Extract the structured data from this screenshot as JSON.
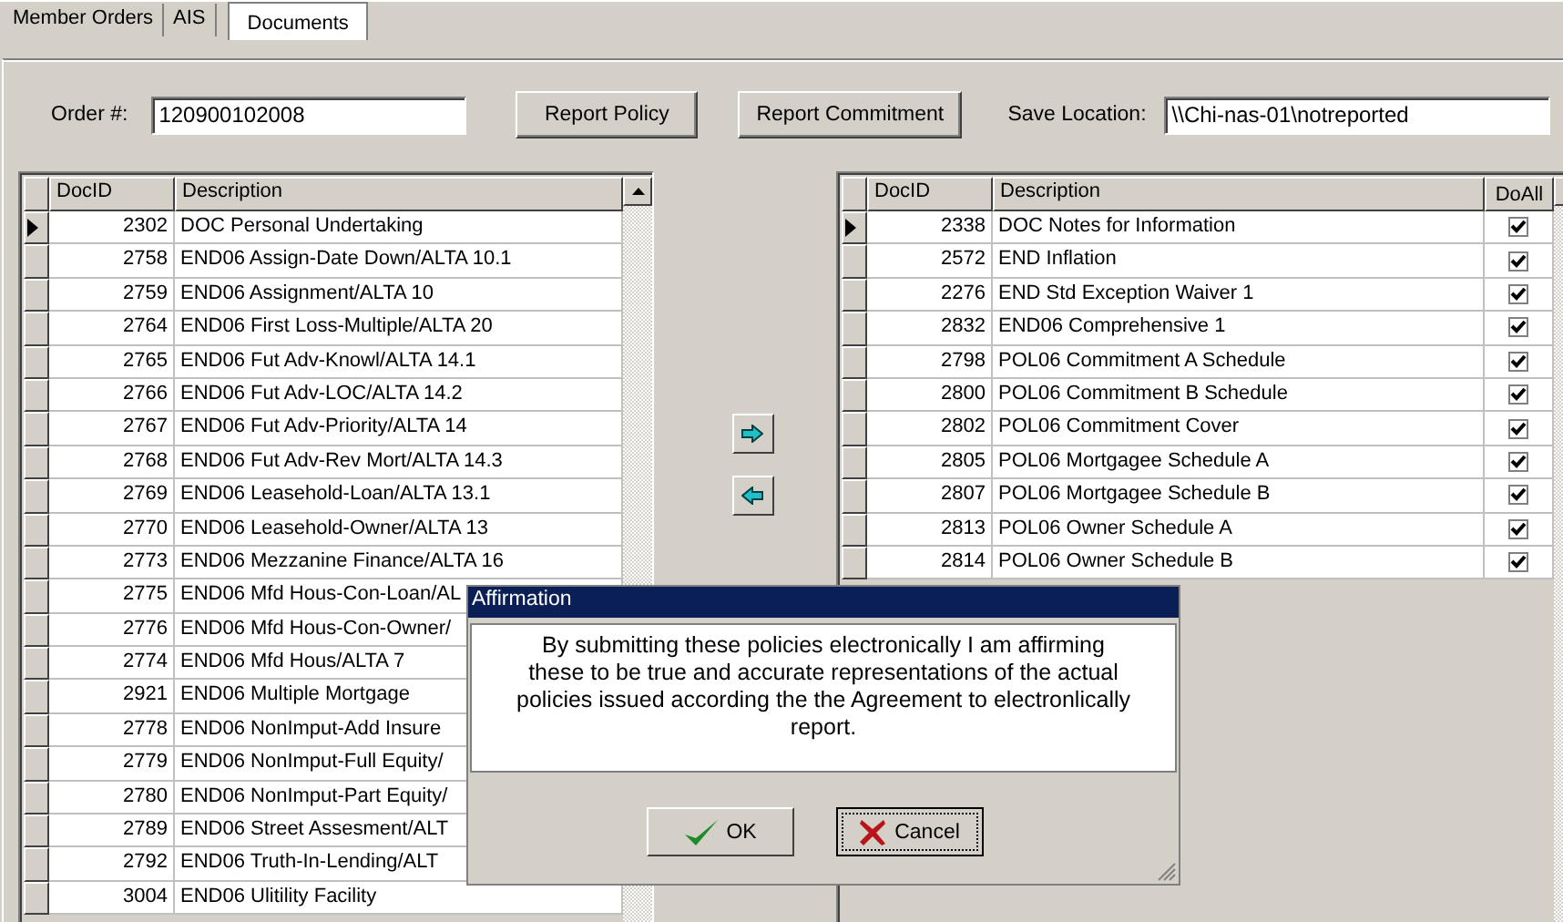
{
  "tabs": [
    {
      "label": "Member Orders",
      "selected": false
    },
    {
      "label": "AIS",
      "selected": false
    },
    {
      "label": "Documents",
      "selected": true
    }
  ],
  "order": {
    "label": "Order #:",
    "value": "120900102008"
  },
  "buttons": [
    "Report Policy",
    "Report Commitment"
  ],
  "save_location": {
    "label": "Save Location:",
    "value": "\\\\Chi-nas-01\\notreported"
  },
  "available_grid": {
    "columns": [
      "DocID",
      "Description"
    ],
    "rows": [
      {
        "doc_id": "2302",
        "description": "DOC Personal Undertaking",
        "selected": true
      },
      {
        "doc_id": "2758",
        "description": "END06 Assign-Date Down/ALTA 10.1",
        "selected": false
      },
      {
        "doc_id": "2759",
        "description": "END06 Assignment/ALTA 10",
        "selected": false
      },
      {
        "doc_id": "2764",
        "description": "END06 First Loss-Multiple/ALTA 20",
        "selected": false
      },
      {
        "doc_id": "2765",
        "description": "END06 Fut Adv-Knowl/ALTA 14.1",
        "selected": false
      },
      {
        "doc_id": "2766",
        "description": "END06 Fut Adv-LOC/ALTA 14.2",
        "selected": false
      },
      {
        "doc_id": "2767",
        "description": "END06 Fut Adv-Priority/ALTA 14",
        "selected": false
      },
      {
        "doc_id": "2768",
        "description": "END06 Fut Adv-Rev Mort/ALTA 14.3",
        "selected": false
      },
      {
        "doc_id": "2769",
        "description": "END06 Leasehold-Loan/ALTA 13.1",
        "selected": false
      },
      {
        "doc_id": "2770",
        "description": "END06 Leasehold-Owner/ALTA 13",
        "selected": false
      },
      {
        "doc_id": "2773",
        "description": "END06 Mezzanine Finance/ALTA 16",
        "selected": false
      },
      {
        "doc_id": "2775",
        "description": "END06 Mfd Hous-Con-Loan/AL",
        "selected": false
      },
      {
        "doc_id": "2776",
        "description": "END06 Mfd Hous-Con-Owner/",
        "selected": false
      },
      {
        "doc_id": "2774",
        "description": "END06 Mfd Hous/ALTA 7",
        "selected": false
      },
      {
        "doc_id": "2921",
        "description": "END06 Multiple Mortgage",
        "selected": false
      },
      {
        "doc_id": "2778",
        "description": "END06 NonImput-Add Insure",
        "selected": false
      },
      {
        "doc_id": "2779",
        "description": "END06 NonImput-Full Equity/",
        "selected": false
      },
      {
        "doc_id": "2780",
        "description": "END06 NonImput-Part Equity/",
        "selected": false
      },
      {
        "doc_id": "2789",
        "description": "END06 Street Assesment/ALT",
        "selected": false
      },
      {
        "doc_id": "2792",
        "description": "END06 Truth-In-Lending/ALT",
        "selected": false
      },
      {
        "doc_id": "3004",
        "description": "END06 Ulitility Facility",
        "selected": false
      }
    ]
  },
  "selected_grid": {
    "columns": [
      "DocID",
      "Description",
      "DoAll"
    ],
    "rows": [
      {
        "doc_id": "2338",
        "description": "DOC Notes for Information",
        "do_all": true,
        "selected": true
      },
      {
        "doc_id": "2572",
        "description": "END Inflation",
        "do_all": true,
        "selected": false
      },
      {
        "doc_id": "2276",
        "description": "END Std Exception Waiver 1",
        "do_all": true,
        "selected": false
      },
      {
        "doc_id": "2832",
        "description": "END06 Comprehensive 1",
        "do_all": true,
        "selected": false
      },
      {
        "doc_id": "2798",
        "description": "POL06 Commitment A Schedule",
        "do_all": true,
        "selected": false
      },
      {
        "doc_id": "2800",
        "description": "POL06 Commitment B Schedule",
        "do_all": true,
        "selected": false
      },
      {
        "doc_id": "2802",
        "description": "POL06 Commitment Cover",
        "do_all": true,
        "selected": false
      },
      {
        "doc_id": "2805",
        "description": "POL06 Mortgagee Schedule A",
        "do_all": true,
        "selected": false
      },
      {
        "doc_id": "2807",
        "description": "POL06 Mortgagee Schedule B",
        "do_all": true,
        "selected": false
      },
      {
        "doc_id": "2813",
        "description": "POL06 Owner Schedule A",
        "do_all": true,
        "selected": false
      },
      {
        "doc_id": "2814",
        "description": "POL06 Owner Schedule B",
        "do_all": true,
        "selected": false
      }
    ]
  },
  "dialog": {
    "title": "Affirmation",
    "message": "By submitting these policies electronically I am affirming these to be true and accurate representations of the actual policies issued according the the Agreement to electronlically report.",
    "buttons": [
      {
        "label": "OK",
        "kind": "ok",
        "focused": false
      },
      {
        "label": "Cancel",
        "kind": "cancel",
        "focused": true
      }
    ]
  }
}
